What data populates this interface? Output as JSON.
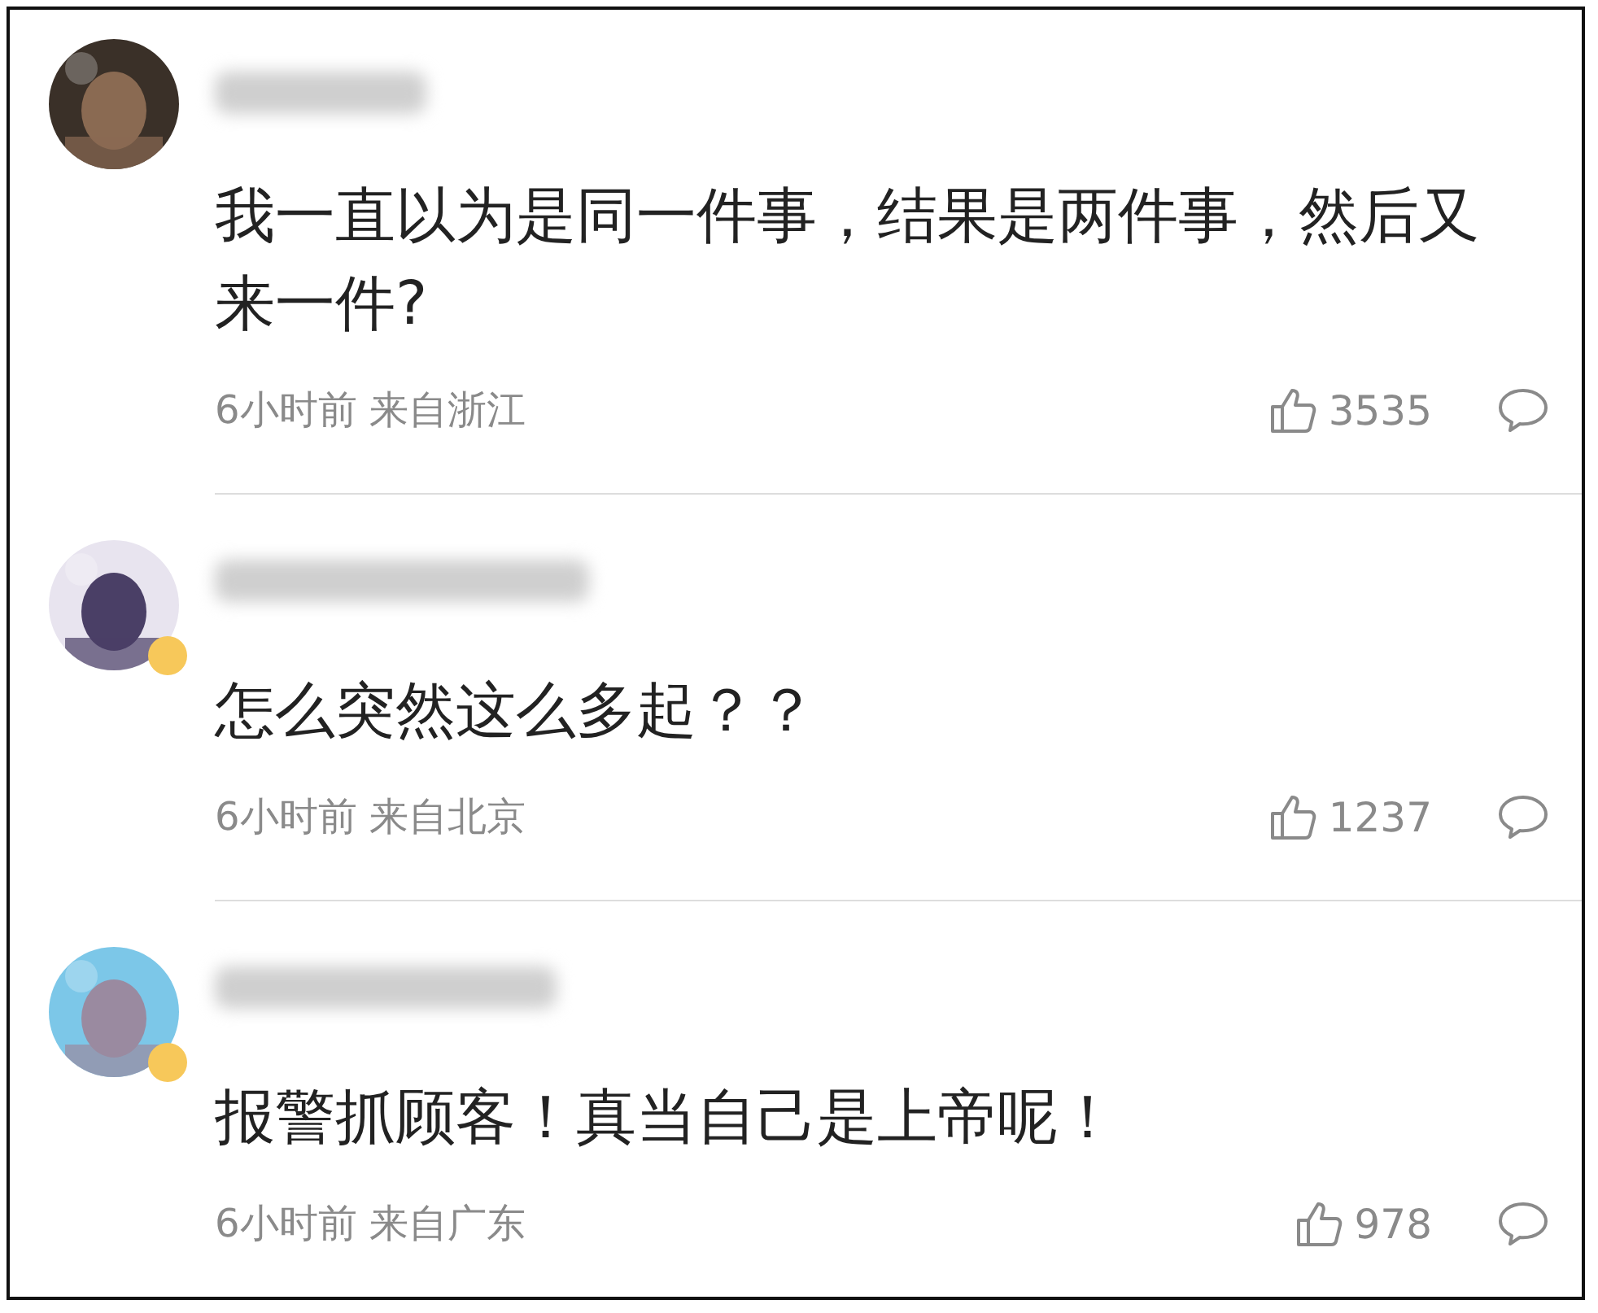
{
  "comments": [
    {
      "verified": false,
      "text": "我一直以为是同一件事，结果是两件事，然后又来一件?",
      "time": "6小时前",
      "location": "来自浙江",
      "likes": "3535"
    },
    {
      "verified": true,
      "text": "怎么突然这么多起？？",
      "time": "6小时前",
      "location": "来自北京",
      "likes": "1237"
    },
    {
      "verified": true,
      "text": "报警抓顾客！真当自己是上帝呢！",
      "time": "6小时前",
      "location": "来自广东",
      "likes": "978"
    }
  ]
}
